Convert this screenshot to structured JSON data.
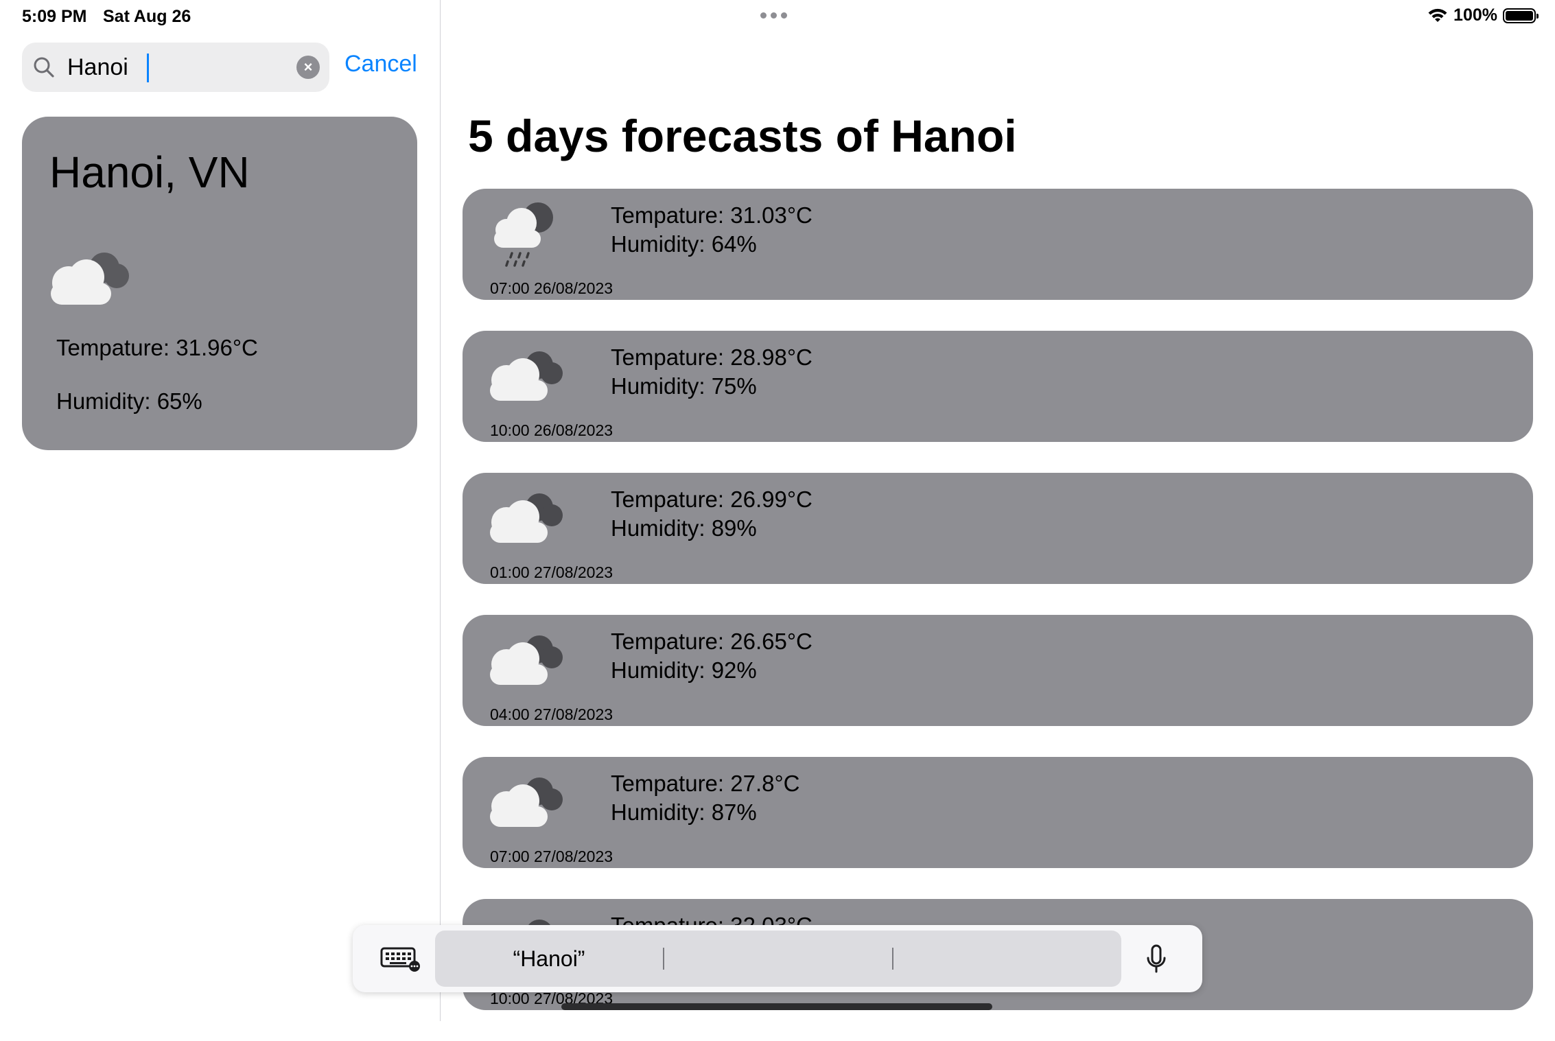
{
  "status": {
    "time": "5:09 PM",
    "date": "Sat Aug 26",
    "battery": "100%",
    "battery_level": 1.0
  },
  "search": {
    "value": "Hanoi",
    "placeholder": "",
    "cancel_label": "Cancel",
    "clear_icon": "clear-icon"
  },
  "current": {
    "city": "Hanoi, VN",
    "icon": "cloudy-icon",
    "temperature": "Tempature: 31.96°C",
    "humidity": "Humidity: 65%"
  },
  "main": {
    "title": "5 days forecasts of Hanoi"
  },
  "forecasts": [
    {
      "icon": "rain-cloud-icon",
      "temperature": "Tempature: 31.03°C",
      "humidity": "Humidity: 64%",
      "time": "07:00 26/08/2023"
    },
    {
      "icon": "cloudy-icon",
      "temperature": "Tempature: 28.98°C",
      "humidity": "Humidity: 75%",
      "time": "10:00 26/08/2023"
    },
    {
      "icon": "cloudy-icon",
      "temperature": "Tempature: 26.99°C",
      "humidity": "Humidity: 89%",
      "time": "01:00 27/08/2023"
    },
    {
      "icon": "cloudy-icon",
      "temperature": "Tempature: 26.65°C",
      "humidity": "Humidity: 92%",
      "time": "04:00 27/08/2023"
    },
    {
      "icon": "cloudy-icon",
      "temperature": "Tempature: 27.8°C",
      "humidity": "Humidity: 87%",
      "time": "07:00 27/08/2023"
    },
    {
      "icon": "cloudy-icon",
      "temperature": "Tempature: 32.03°C",
      "humidity": "",
      "time": "10:00 27/08/2023"
    }
  ],
  "dictation": {
    "suggestions": [
      "“Hanoi”",
      "",
      ""
    ]
  },
  "colors": {
    "card": "#8e8e93",
    "accent": "#0a84ff"
  }
}
